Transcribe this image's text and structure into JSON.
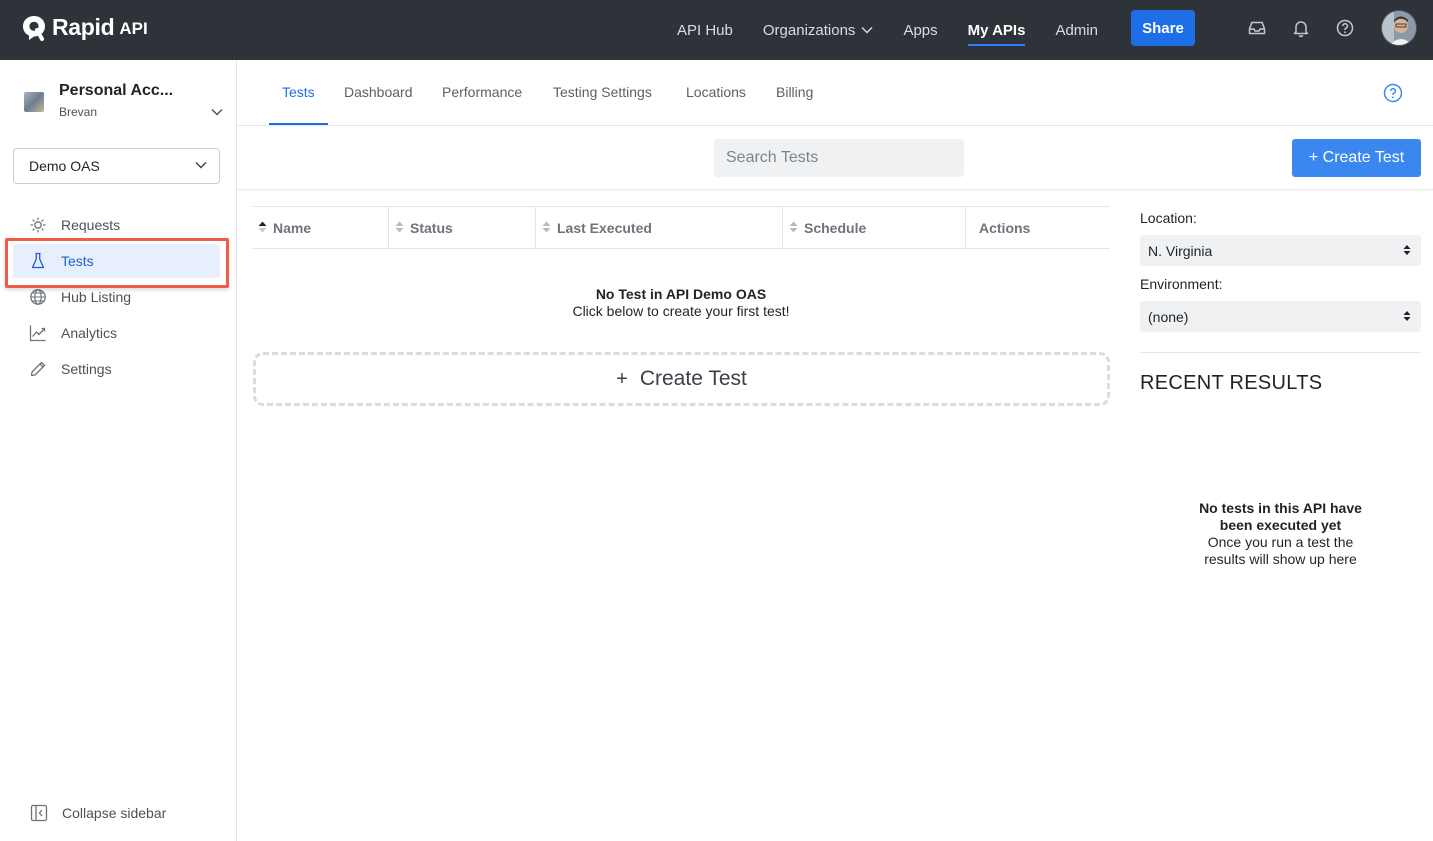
{
  "brand": {
    "name": "Rapid",
    "suffix": "API"
  },
  "topnav": {
    "items": [
      {
        "label": "API Hub",
        "active": false
      },
      {
        "label": "Organizations",
        "active": false,
        "has_dropdown": true
      },
      {
        "label": "Apps",
        "active": false
      },
      {
        "label": "My APIs",
        "active": true
      },
      {
        "label": "Admin",
        "active": false
      }
    ],
    "share_label": "Share",
    "icons": [
      "inbox-icon",
      "bell-icon",
      "help-icon"
    ]
  },
  "sidebar": {
    "account_name": "Personal Acc...",
    "account_user": "Brevan",
    "api_select": "Demo OAS",
    "items": [
      {
        "label": "Requests",
        "icon": "requests-icon",
        "active": false
      },
      {
        "label": "Tests",
        "icon": "flask-icon",
        "active": true
      },
      {
        "label": "Hub Listing",
        "icon": "globe-icon",
        "active": false
      },
      {
        "label": "Analytics",
        "icon": "chart-icon",
        "active": false
      },
      {
        "label": "Settings",
        "icon": "pencil-icon",
        "active": false
      }
    ],
    "collapse_label": "Collapse sidebar"
  },
  "tabs": [
    {
      "label": "Tests",
      "active": true
    },
    {
      "label": "Dashboard",
      "active": false
    },
    {
      "label": "Performance",
      "active": false
    },
    {
      "label": "Testing Settings",
      "active": false
    },
    {
      "label": "Locations",
      "active": false
    },
    {
      "label": "Billing",
      "active": false
    }
  ],
  "toolbar": {
    "search_placeholder": "Search Tests",
    "create_label": "+ Create Test"
  },
  "table": {
    "columns": [
      "Name",
      "Status",
      "Last Executed",
      "Schedule",
      "Actions"
    ],
    "empty_title": "No Test in API Demo OAS",
    "empty_sub": "Click below to create your first test!",
    "create_plus": "+",
    "create_label": "Create Test"
  },
  "right_panel": {
    "location_label": "Location:",
    "location_value": "N. Virginia",
    "environment_label": "Environment:",
    "environment_value": "(none)",
    "recent_title": "RECENT RESULTS",
    "empty_title_1": "No tests in this API have",
    "empty_title_2": "been executed yet",
    "empty_sub_1": "Once you run a test the",
    "empty_sub_2": "results will show up here"
  },
  "colors": {
    "accent": "#1e6ee8",
    "topbar": "#2d3339",
    "highlight": "#ef5b4c"
  }
}
